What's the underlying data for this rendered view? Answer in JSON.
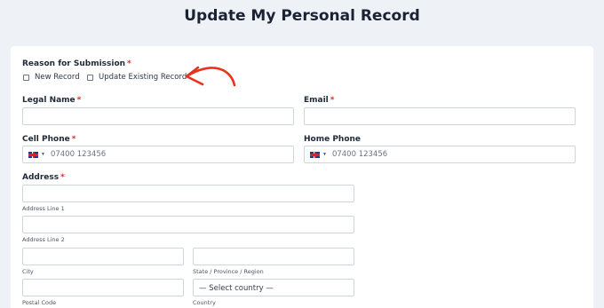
{
  "page": {
    "title": "Update My Personal Record"
  },
  "reason": {
    "label": "Reason for Submission",
    "required_mark": "*",
    "options": [
      "New Record",
      "Update Existing Record"
    ]
  },
  "legal_name": {
    "label": "Legal Name",
    "required_mark": "*",
    "value": ""
  },
  "email": {
    "label": "Email",
    "required_mark": "*",
    "value": ""
  },
  "cell_phone": {
    "label": "Cell Phone",
    "required_mark": "*",
    "flag": "gb-flag-icon",
    "placeholder": "07400 123456"
  },
  "home_phone": {
    "label": "Home Phone",
    "flag": "gb-flag-icon",
    "placeholder": "07400 123456"
  },
  "address": {
    "label": "Address",
    "required_mark": "*",
    "line1_label": "Address Line 1",
    "line2_label": "Address Line 2",
    "city_label": "City",
    "state_label": "State / Province / Region",
    "postal_label": "Postal Code",
    "country_label": "Country",
    "country_value": "— Select country —"
  },
  "colors": {
    "background": "#eef2f7",
    "required": "#d93025",
    "annotation_arrow": "#e8331c"
  }
}
